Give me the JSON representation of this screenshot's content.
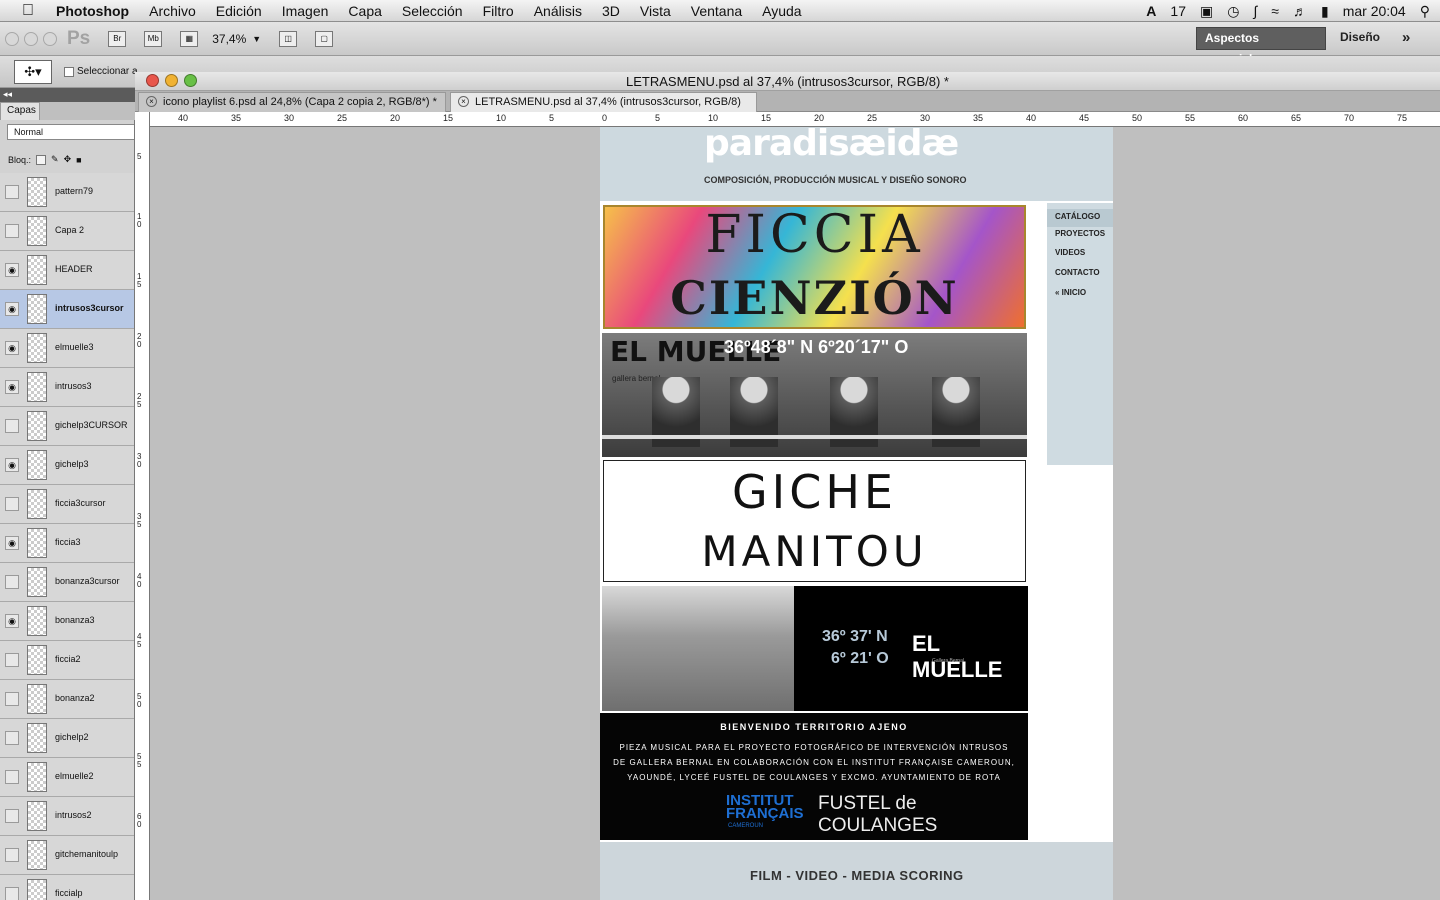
{
  "menubar": {
    "app": "Photoshop",
    "items": [
      "Archivo",
      "Edición",
      "Imagen",
      "Capa",
      "Selección",
      "Filtro",
      "Análisis",
      "3D",
      "Vista",
      "Ventana",
      "Ayuda"
    ],
    "status": {
      "adobe_count": "17",
      "clock": "mar 20:04"
    }
  },
  "optionsbar": {
    "zoom": "37,4%",
    "br": "Br",
    "mb": "Mb",
    "ps": "Ps",
    "workspaces": [
      "Aspectos esenciales",
      "Diseño"
    ],
    "more": "»"
  },
  "tooloptions": {
    "autoselect_label": "Seleccionar a"
  },
  "document": {
    "title": "LETRASMENU.psd al 37,4% (intrusos3cursor, RGB/8) *",
    "tabs": [
      {
        "label": "icono playlist 6.psd al 24,8% (Capa 2 copia 2, RGB/8*) *",
        "active": false
      },
      {
        "label": "LETRASMENU.psd al 37,4% (intrusos3cursor, RGB/8) *",
        "active": true
      }
    ]
  },
  "rulers": {
    "h": [
      "40",
      "35",
      "30",
      "25",
      "20",
      "15",
      "10",
      "5",
      "0",
      "5",
      "10",
      "15",
      "20",
      "25",
      "30",
      "35",
      "40",
      "45",
      "50",
      "55",
      "60",
      "65",
      "70",
      "75"
    ],
    "v": [
      "5",
      "1 0",
      "1 5",
      "2 0",
      "2 5",
      "3 0",
      "3 5",
      "4 0",
      "4 5",
      "5 0",
      "5 5",
      "6 0"
    ]
  },
  "layers_panel": {
    "tab": "Capas",
    "blend_mode": "Normal",
    "lock_label": "Bloq.:",
    "layers": [
      {
        "name": "pattern79",
        "visible": false,
        "selected": false
      },
      {
        "name": "Capa 2",
        "visible": false,
        "selected": false
      },
      {
        "name": "HEADER",
        "visible": true,
        "selected": false
      },
      {
        "name": "intrusos3cursor",
        "visible": true,
        "selected": true
      },
      {
        "name": "elmuelle3",
        "visible": true,
        "selected": false
      },
      {
        "name": "intrusos3",
        "visible": true,
        "selected": false
      },
      {
        "name": "gichelp3CURSOR",
        "visible": false,
        "selected": false
      },
      {
        "name": "gichelp3",
        "visible": true,
        "selected": false
      },
      {
        "name": "ficcia3cursor",
        "visible": false,
        "selected": false
      },
      {
        "name": "ficcia3",
        "visible": true,
        "selected": false
      },
      {
        "name": "bonanza3cursor",
        "visible": false,
        "selected": false
      },
      {
        "name": "bonanza3",
        "visible": true,
        "selected": false
      },
      {
        "name": "ficcia2",
        "visible": false,
        "selected": false
      },
      {
        "name": "bonanza2",
        "visible": false,
        "selected": false
      },
      {
        "name": "gichelp2",
        "visible": false,
        "selected": false
      },
      {
        "name": "elmuelle2",
        "visible": false,
        "selected": false
      },
      {
        "name": "intrusos2",
        "visible": false,
        "selected": false
      },
      {
        "name": "gitchemanitoulp",
        "visible": false,
        "selected": false
      },
      {
        "name": "ficcialp",
        "visible": false,
        "selected": false
      }
    ]
  },
  "artwork": {
    "logo": "paradisæidæ",
    "tagline": "COMPOSICIÓN, PRODUCCIÓN MUSICAL Y DISEÑO SONORO",
    "nav": [
      "CATÁLOGO",
      "PROYECTOS",
      "VIDEOS",
      "CONTACTO",
      "« INICIO"
    ],
    "banner1": [
      "FICCIA",
      "CIENZIÓN"
    ],
    "banner2": {
      "logo": "EL MUELLE",
      "sub": "gallera bernal",
      "coords": "36º48´8\" N 6º20´17\" O"
    },
    "banner3": [
      "GICHE",
      "MANITOU"
    ],
    "banner4": {
      "coord1": "36º 37' N",
      "coord2": "6º 21' O",
      "logo": "EL MUELLE",
      "sub": "Gallera Bernal"
    },
    "welcome": {
      "title": "BIENVENIDO TERRITORIO AJENO",
      "lines": [
        "PIEZA MUSICAL PARA EL PROYECTO FOTOGRÁFICO DE INTERVENCIÓN INTRUSOS",
        "DE GALLERA BERNAL EN COLABORACIÓN CON EL INSTITUT FRANÇAISE CAMEROUN,",
        "YAOUNDÉ, LYCEÉ FUSTEL DE COULANGES Y EXCMO. AYUNTAMIENTO DE ROTA"
      ],
      "logo1": [
        "INSTITUT",
        "FRANÇAIS"
      ],
      "logo1_sub": "CAMEROUN",
      "logo2": "FUSTEL de COULANGES"
    },
    "footer": "FILM - VIDEO - MEDIA SCORING"
  }
}
